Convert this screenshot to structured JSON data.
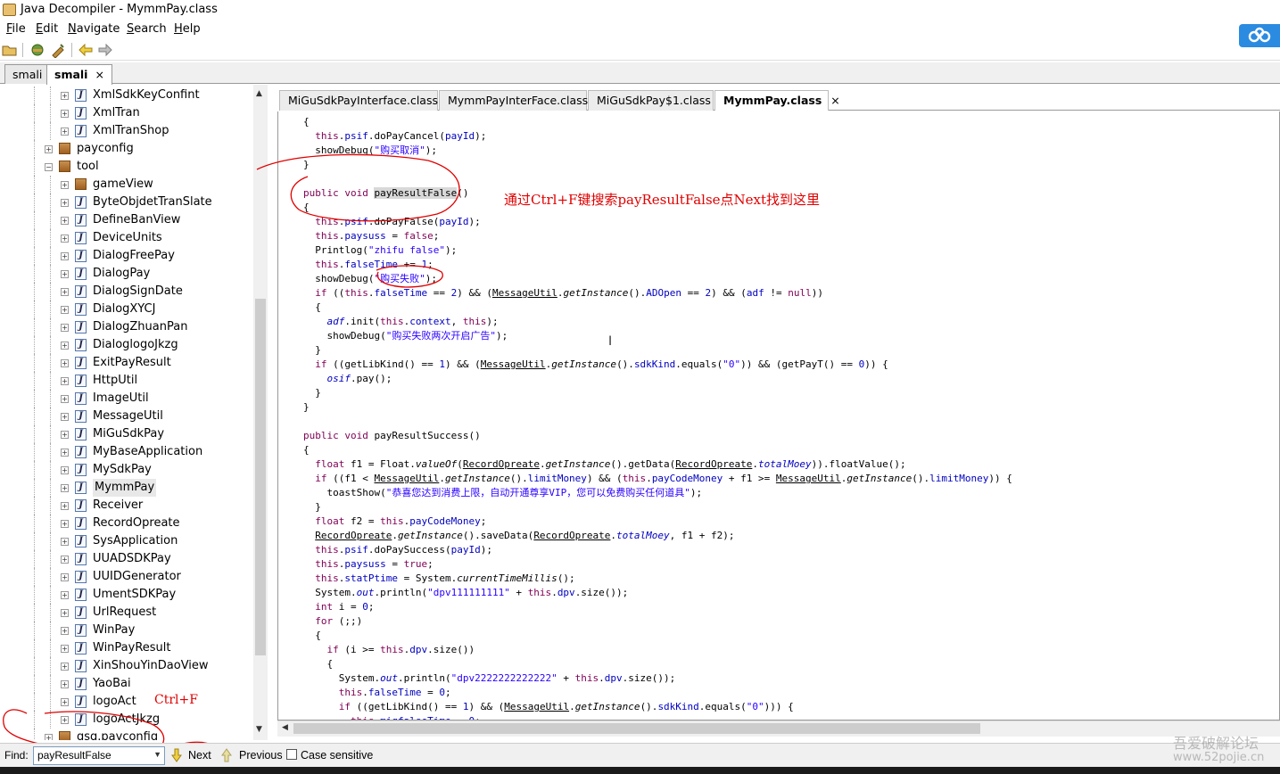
{
  "window": {
    "title": "Java Decompiler - MymmPay.class"
  },
  "menu": [
    {
      "u": "F",
      "rest": "ile"
    },
    {
      "u": "E",
      "rest": "dit"
    },
    {
      "u": "N",
      "rest": "avigate"
    },
    {
      "u": "S",
      "rest": "earch"
    },
    {
      "u": "H",
      "rest": "elp"
    }
  ],
  "outer_tabs": [
    {
      "label": "smali",
      "active": false
    },
    {
      "label": "smali",
      "active": true,
      "close": "×"
    }
  ],
  "tree": {
    "items": [
      {
        "label": "XmlSdkKeyConfint",
        "kind": "class",
        "depth": 2
      },
      {
        "label": "XmlTran",
        "kind": "class",
        "depth": 2
      },
      {
        "label": "XmlTranShop",
        "kind": "class",
        "depth": 2
      },
      {
        "label": "payconfig",
        "kind": "package",
        "depth": 1,
        "expanded": false
      },
      {
        "label": "tool",
        "kind": "package",
        "depth": 1,
        "expanded": true
      },
      {
        "label": "gameView",
        "kind": "package",
        "depth": 2
      },
      {
        "label": "ByteObjdetTranSlate",
        "kind": "class",
        "depth": 2
      },
      {
        "label": "DefineBanView",
        "kind": "class",
        "depth": 2
      },
      {
        "label": "DeviceUnits",
        "kind": "class",
        "depth": 2
      },
      {
        "label": "DialogFreePay",
        "kind": "class",
        "depth": 2
      },
      {
        "label": "DialogPay",
        "kind": "class",
        "depth": 2
      },
      {
        "label": "DialogSignDate",
        "kind": "class",
        "depth": 2
      },
      {
        "label": "DialogXYCJ",
        "kind": "class",
        "depth": 2
      },
      {
        "label": "DialogZhuanPan",
        "kind": "class",
        "depth": 2
      },
      {
        "label": "DialoglogoJkzg",
        "kind": "class",
        "depth": 2
      },
      {
        "label": "ExitPayResult",
        "kind": "class",
        "depth": 2
      },
      {
        "label": "HttpUtil",
        "kind": "class",
        "depth": 2
      },
      {
        "label": "ImageUtil",
        "kind": "class",
        "depth": 2
      },
      {
        "label": "MessageUtil",
        "kind": "class",
        "depth": 2
      },
      {
        "label": "MiGuSdkPay",
        "kind": "class",
        "depth": 2
      },
      {
        "label": "MyBaseApplication",
        "kind": "class",
        "depth": 2
      },
      {
        "label": "MySdkPay",
        "kind": "class",
        "depth": 2
      },
      {
        "label": "MymmPay",
        "kind": "class",
        "depth": 2,
        "selected": true
      },
      {
        "label": "Receiver",
        "kind": "class",
        "depth": 2
      },
      {
        "label": "RecordOpreate",
        "kind": "class",
        "depth": 2
      },
      {
        "label": "SysApplication",
        "kind": "class",
        "depth": 2
      },
      {
        "label": "UUADSDKPay",
        "kind": "class",
        "depth": 2
      },
      {
        "label": "UUIDGenerator",
        "kind": "class",
        "depth": 2
      },
      {
        "label": "UmentSDKPay",
        "kind": "class",
        "depth": 2
      },
      {
        "label": "UrlRequest",
        "kind": "class",
        "depth": 2
      },
      {
        "label": "WinPay",
        "kind": "class",
        "depth": 2
      },
      {
        "label": "WinPayResult",
        "kind": "class",
        "depth": 2
      },
      {
        "label": "XinShouYinDaoView",
        "kind": "class",
        "depth": 2
      },
      {
        "label": "YaoBai",
        "kind": "class",
        "depth": 2
      },
      {
        "label": "logoAct",
        "kind": "class",
        "depth": 2
      },
      {
        "label": "logoActJkzg",
        "kind": "class",
        "depth": 2
      },
      {
        "label": "gsq.payconfig",
        "kind": "package",
        "depth": 1
      }
    ]
  },
  "editor_tabs": [
    {
      "label": "MiGuSdkPayInterface.class",
      "active": false
    },
    {
      "label": "MymmPayInterFace.class",
      "active": false
    },
    {
      "label": "MiGuSdkPay$1.class",
      "active": false
    },
    {
      "label": "MymmPay.class",
      "active": true,
      "close": "×"
    }
  ],
  "annotations": {
    "main_note": "通过Ctrl+F键搜索payResultFalse点Next找到这里",
    "ctrlf_note": "Ctrl+F",
    "watermark_line1": "吾爱破解论坛",
    "watermark_line2": "www.52pojie.cn"
  },
  "find_bar": {
    "label": "Find:",
    "value": "payResultFalse",
    "next_label": "Next",
    "previous_label": "Previous",
    "case_label": "Case sensitive",
    "case_checked": false
  },
  "icons": {
    "app": "coffee-cup-icon",
    "open": "open-folder-icon",
    "open_type": "open-type-icon",
    "paste": "paste-icon",
    "back": "back-arrow-icon",
    "forward": "forward-arrow-icon",
    "cloud": "baidu-cloud-icon"
  },
  "colors": {
    "annotation": "#e00000",
    "keyword": "#7f0055",
    "field": "#0000c0",
    "string": "#2a00ff"
  }
}
